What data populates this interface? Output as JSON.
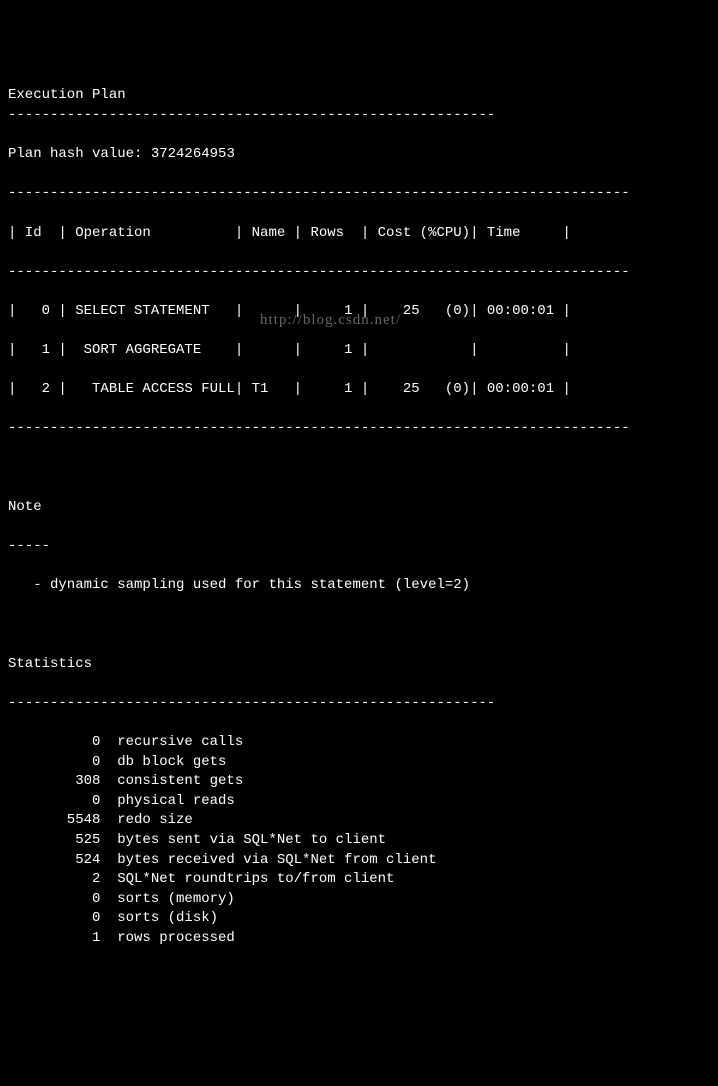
{
  "header": {
    "title": "Execution Plan",
    "dash1": "----------------------------------------------------------",
    "plan_hash_label": "Plan hash value: ",
    "plan_hash_value": "3724264953"
  },
  "plan_table": {
    "dash": "--------------------------------------------------------------------------",
    "header_row": "| Id  | Operation          | Name | Rows  | Cost (%CPU)| Time     |",
    "rows": [
      "|   0 | SELECT STATEMENT   |      |     1 |    25   (0)| 00:00:01 |",
      "|   1 |  SORT AGGREGATE    |      |     1 |            |          |",
      "|   2 |   TABLE ACCESS FULL| T1   |     1 |    25   (0)| 00:00:01 |"
    ]
  },
  "note": {
    "title": "Note",
    "dash": "-----",
    "line": "   - dynamic sampling used for this statement (level=2)"
  },
  "watermark": "http://blog.csdn.net/",
  "statistics": {
    "title": "Statistics",
    "dash": "----------------------------------------------------------",
    "rows": [
      {
        "value": "0",
        "label": "recursive calls"
      },
      {
        "value": "0",
        "label": "db block gets"
      },
      {
        "value": "308",
        "label": "consistent gets"
      },
      {
        "value": "0",
        "label": "physical reads"
      },
      {
        "value": "5548",
        "label": "redo size"
      },
      {
        "value": "525",
        "label": "bytes sent via SQL*Net to client"
      },
      {
        "value": "524",
        "label": "bytes received via SQL*Net from client"
      },
      {
        "value": "2",
        "label": "SQL*Net roundtrips to/from client"
      },
      {
        "value": "0",
        "label": "sorts (memory)"
      },
      {
        "value": "0",
        "label": "sorts (disk)"
      },
      {
        "value": "1",
        "label": "rows processed"
      }
    ]
  }
}
